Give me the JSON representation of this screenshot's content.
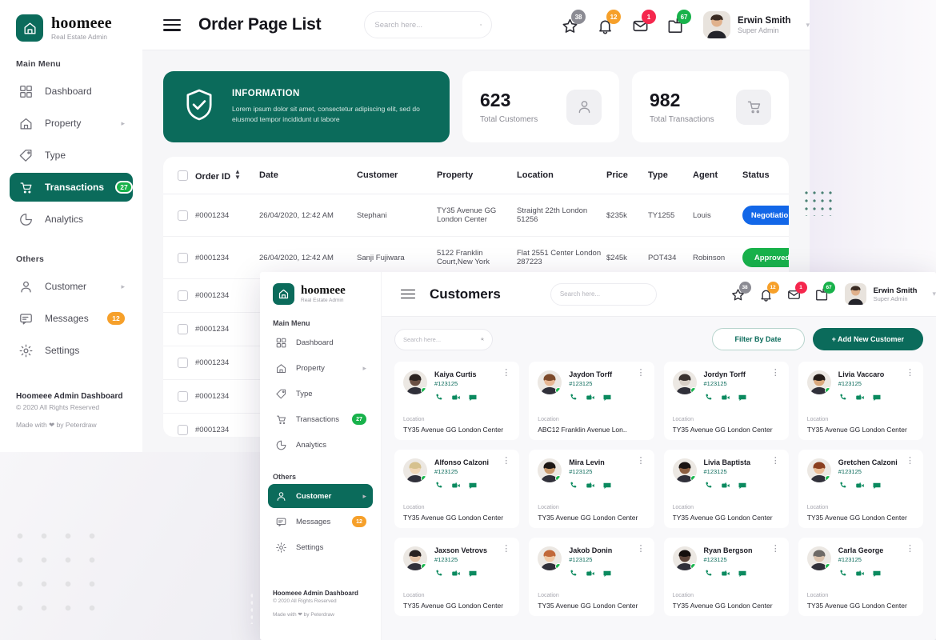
{
  "brand": {
    "name": "hoomeee",
    "tagline": "Real Estate Admin"
  },
  "sidebar": {
    "main_label": "Main Menu",
    "others_label": "Others",
    "main_items": [
      {
        "label": "Dashboard",
        "icon": "grid-icon",
        "badge": null,
        "caret": false,
        "active": false
      },
      {
        "label": "Property",
        "icon": "home-icon",
        "badge": null,
        "caret": true,
        "active": false
      },
      {
        "label": "Type",
        "icon": "tag-icon",
        "badge": null,
        "caret": false,
        "active": false
      },
      {
        "label": "Transactions",
        "icon": "cart-icon",
        "badge": "27",
        "badge_color": "#18b24b",
        "caret": false,
        "active": true
      },
      {
        "label": "Analytics",
        "icon": "pie-chart-icon",
        "badge": null,
        "caret": false,
        "active": false
      }
    ],
    "other_items": [
      {
        "label": "Customer",
        "icon": "user-icon",
        "badge": null,
        "caret": true,
        "active": false
      },
      {
        "label": "Messages",
        "icon": "message-icon",
        "badge": "12",
        "badge_color": "#f6a02a",
        "caret": false,
        "active": false
      },
      {
        "label": "Settings",
        "icon": "gear-icon",
        "badge": null,
        "caret": false,
        "active": false
      }
    ],
    "footer": {
      "title": "Hoomeee Admin Dashboard",
      "copyright": "© 2020 All Rights Reserved",
      "made_with": "Made with ❤ by Peterdraw"
    }
  },
  "topbar": {
    "page_title": "Order Page List",
    "search_placeholder": "Search here...",
    "icons": [
      {
        "name": "star-icon",
        "count": "38",
        "color": "#8b8b93"
      },
      {
        "name": "bell-icon",
        "count": "12",
        "color": "#f6a02a"
      },
      {
        "name": "mail-icon",
        "count": "1",
        "color": "#f5274d"
      },
      {
        "name": "folder-icon",
        "count": "67",
        "color": "#18b24b"
      }
    ],
    "user": {
      "name": "Erwin Smith",
      "role": "Super Admin"
    }
  },
  "info_card": {
    "title": "INFORMATION",
    "body": "Lorem ipsum dolor sit amet, consectetur adipiscing elit, sed do eiusmod tempor incididunt ut labore",
    "icon": "shield-check-icon",
    "color": "#0b6b5b"
  },
  "stats": [
    {
      "value": "623",
      "label": "Total Customers",
      "icon": "user-icon"
    },
    {
      "value": "982",
      "label": "Total Transactions",
      "icon": "cart-icon"
    }
  ],
  "table": {
    "columns": [
      "Order ID",
      "Date",
      "Customer",
      "Property",
      "Location",
      "Price",
      "Type",
      "Agent",
      "Status"
    ],
    "rows": [
      {
        "order_id": "#0001234",
        "date": "26/04/2020, 12:42 AM",
        "customer": "Stephani",
        "property": "TY35 Avenue GG London Center",
        "location": "Straight 22th London 51256",
        "price": "$235k",
        "type": "TY1255",
        "agent": "Louis",
        "status": "Negotiation",
        "status_color": "#1267e8"
      },
      {
        "order_id": "#0001234",
        "date": "26/04/2020, 12:42 AM",
        "customer": "Sanji Fujiwara",
        "property": "5122 Franklin Court,New York",
        "location": "Flat 2551 Center London 287223",
        "price": "$245k",
        "type": "POT434",
        "agent": "Robinson",
        "status": "Approved",
        "status_color": "#18b24b"
      },
      {
        "order_id": "#0001234",
        "date": "",
        "customer": "",
        "property": "",
        "location": "",
        "price": "",
        "type": "",
        "agent": "",
        "status": "",
        "status_color": ""
      },
      {
        "order_id": "#0001234",
        "date": "",
        "customer": "",
        "property": "",
        "location": "",
        "price": "",
        "type": "",
        "agent": "",
        "status": "",
        "status_color": ""
      },
      {
        "order_id": "#0001234",
        "date": "",
        "customer": "",
        "property": "",
        "location": "",
        "price": "",
        "type": "",
        "agent": "",
        "status": "",
        "status_color": ""
      },
      {
        "order_id": "#0001234",
        "date": "",
        "customer": "",
        "property": "",
        "location": "",
        "price": "",
        "type": "",
        "agent": "",
        "status": "",
        "status_color": ""
      },
      {
        "order_id": "#0001234",
        "date": "",
        "customer": "",
        "property": "",
        "location": "",
        "price": "",
        "type": "",
        "agent": "",
        "status": "",
        "status_color": ""
      }
    ]
  },
  "modal": {
    "topbar": {
      "page_title": "Customers",
      "search_placeholder": "Search here...",
      "icons": [
        {
          "name": "star-icon",
          "count": "38",
          "color": "#8b8b93"
        },
        {
          "name": "bell-icon",
          "count": "12",
          "color": "#f6a02a"
        },
        {
          "name": "mail-icon",
          "count": "1",
          "color": "#f5274d"
        },
        {
          "name": "folder-icon",
          "count": "67",
          "color": "#18b24b"
        }
      ],
      "user": {
        "name": "Erwin Smith",
        "role": "Super Admin"
      }
    },
    "sidebar": {
      "main_label": "Main Menu",
      "others_label": "Others",
      "main_items": [
        {
          "label": "Dashboard",
          "icon": "grid-icon",
          "badge": null,
          "caret": false,
          "active": false
        },
        {
          "label": "Property",
          "icon": "home-icon",
          "badge": null,
          "caret": true,
          "active": false
        },
        {
          "label": "Type",
          "icon": "tag-icon",
          "badge": null,
          "caret": false,
          "active": false
        },
        {
          "label": "Transactions",
          "icon": "cart-icon",
          "badge": "27",
          "badge_color": "#18b24b",
          "caret": false,
          "active": false
        },
        {
          "label": "Analytics",
          "icon": "pie-chart-icon",
          "badge": null,
          "caret": false,
          "active": false
        }
      ],
      "other_items": [
        {
          "label": "Customer",
          "icon": "user-icon",
          "badge": null,
          "caret": true,
          "active": true
        },
        {
          "label": "Messages",
          "icon": "message-icon",
          "badge": "12",
          "badge_color": "#f6a02a",
          "caret": false,
          "active": false
        },
        {
          "label": "Settings",
          "icon": "gear-icon",
          "badge": null,
          "caret": false,
          "active": false
        }
      ],
      "footer": {
        "title": "Hoomeee Admin Dashboard",
        "copyright": "© 2020 All Rights Reserved",
        "made_with": "Made with ❤ by Peterdraw"
      }
    },
    "toolbar": {
      "search_placeholder": "Search here...",
      "filter_button": "Filter By Date",
      "add_button": "+ Add New Customer"
    },
    "location_label": "Location",
    "customers": [
      {
        "name": "Kaiya Curtis",
        "id": "#123125",
        "location": "TY35 Avenue GG London Center",
        "skin": "#6b5044",
        "hair": "#2b2320",
        "online": true
      },
      {
        "name": "Jaydon Torff",
        "id": "#123125",
        "location": "ABC12 Franklin Avenue Lon..",
        "skin": "#e7b793",
        "hair": "#7d4a2a",
        "online": true
      },
      {
        "name": "Jordyn Torff",
        "id": "#123125",
        "location": "TY35 Avenue GG London Center",
        "skin": "#d8cfc6",
        "hair": "#3a3330",
        "online": true
      },
      {
        "name": "Livia Vaccaro",
        "id": "#123125",
        "location": "TY35 Avenue GG London Center",
        "skin": "#d9a87c",
        "hair": "#241c18",
        "online": true
      },
      {
        "name": "Alfonso Calzoni",
        "id": "#123125",
        "location": "TY35 Avenue GG London Center",
        "skin": "#f0d7b6",
        "hair": "#d6c18e",
        "online": true
      },
      {
        "name": "Mira Levin",
        "id": "#123125",
        "location": "TY35 Avenue GG London Center",
        "skin": "#c99a6d",
        "hair": "#1d1714",
        "online": true
      },
      {
        "name": "Livia Baptista",
        "id": "#123125",
        "location": "TY35 Avenue GG London Center",
        "skin": "#8c5f41",
        "hair": "#1a1412",
        "online": true
      },
      {
        "name": "Gretchen Calzoni",
        "id": "#123125",
        "location": "TY35 Avenue GG London Center",
        "skin": "#e9bb94",
        "hair": "#8b3f1f",
        "online": true
      },
      {
        "name": "Jaxson Vetrovs",
        "id": "#123125",
        "location": "TY35 Avenue GG London Center",
        "skin": "#e5c3a6",
        "hair": "#2a2220",
        "online": true
      },
      {
        "name": "Jakob Donin",
        "id": "#123125",
        "location": "TY35 Avenue GG London Center",
        "skin": "#f0c9a5",
        "hair": "#c1693a",
        "online": true
      },
      {
        "name": "Ryan Bergson",
        "id": "#123125",
        "location": "TY35 Avenue GG London Center",
        "skin": "#5d453a",
        "hair": "#140f0d",
        "online": true
      },
      {
        "name": "Carla George",
        "id": "#123125",
        "location": "TY35 Avenue GG London Center",
        "skin": "#dcc3ad",
        "hair": "#6e6a66",
        "online": true
      }
    ],
    "card_actions": [
      "phone-icon",
      "video-icon",
      "chat-icon"
    ]
  }
}
